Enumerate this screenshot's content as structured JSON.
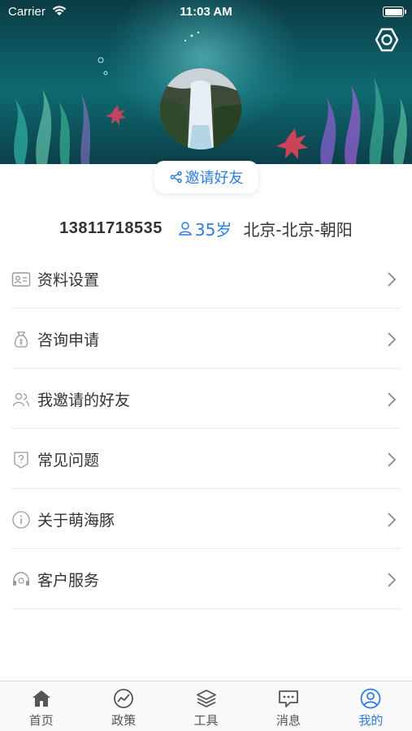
{
  "status_bar": {
    "carrier": "Carrier",
    "time": "11:03 AM"
  },
  "profile": {
    "invite_label": "邀请好友",
    "phone": "13811718535",
    "age": "35岁",
    "location": "北京-北京-朝阳"
  },
  "menu": [
    {
      "label": "资料设置",
      "icon": "id-card-icon"
    },
    {
      "label": "咨询申请",
      "icon": "money-bag-icon"
    },
    {
      "label": "我邀请的好友",
      "icon": "users-icon"
    },
    {
      "label": "常见问题",
      "icon": "question-shield-icon"
    },
    {
      "label": "关于萌海豚",
      "icon": "info-icon"
    },
    {
      "label": "客户服务",
      "icon": "headset-icon"
    }
  ],
  "tabbar": {
    "tabs": [
      {
        "label": "首页",
        "icon": "home-icon"
      },
      {
        "label": "政策",
        "icon": "chart-icon"
      },
      {
        "label": "工具",
        "icon": "layers-icon"
      },
      {
        "label": "消息",
        "icon": "message-icon"
      },
      {
        "label": "我的",
        "icon": "user-circle-icon",
        "active": true
      }
    ]
  },
  "colors": {
    "accent": "#2f7de1",
    "banner": "#0d5a63"
  }
}
